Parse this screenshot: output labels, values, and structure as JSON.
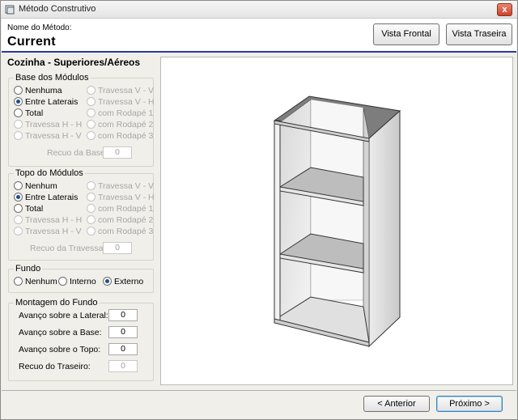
{
  "window": {
    "title": "Método Construtivo",
    "close": "x"
  },
  "header": {
    "label": "Nome do Método:",
    "value": "Current"
  },
  "toolbar": {
    "front_view": "Vista Frontal",
    "back_view": "Vista Traseira"
  },
  "section": {
    "title": "Cozinha - Superiores/Aéreos"
  },
  "base": {
    "title": "Base dos Módulos",
    "left": [
      {
        "label": "Nenhuma",
        "selected": false,
        "enabled": true
      },
      {
        "label": "Entre Laterais",
        "selected": true,
        "enabled": true
      },
      {
        "label": "Total",
        "selected": false,
        "enabled": true
      },
      {
        "label": "Travessa H - H",
        "selected": false,
        "enabled": false
      },
      {
        "label": "Travessa H - V",
        "selected": false,
        "enabled": false
      }
    ],
    "right": [
      {
        "label": "Travessa V - V",
        "selected": false,
        "enabled": false
      },
      {
        "label": "Travessa V - H",
        "selected": false,
        "enabled": false
      },
      {
        "label": "com Rodapé 1",
        "selected": false,
        "enabled": false
      },
      {
        "label": "com Rodapé 2",
        "selected": false,
        "enabled": false
      },
      {
        "label": "com Rodapé 3",
        "selected": false,
        "enabled": false
      }
    ],
    "recuo_label": "Recuo da Base:",
    "recuo_value": "0"
  },
  "topo": {
    "title": "Topo do Módulos",
    "left": [
      {
        "label": "Nenhum",
        "selected": false,
        "enabled": true
      },
      {
        "label": "Entre Laterais",
        "selected": true,
        "enabled": true
      },
      {
        "label": "Total",
        "selected": false,
        "enabled": true
      },
      {
        "label": "Travessa H - H",
        "selected": false,
        "enabled": false
      },
      {
        "label": "Travessa H - V",
        "selected": false,
        "enabled": false
      }
    ],
    "right": [
      {
        "label": "Travessa V - V",
        "selected": false,
        "enabled": false
      },
      {
        "label": "Travessa V - H",
        "selected": false,
        "enabled": false
      },
      {
        "label": "com Rodapé 1",
        "selected": false,
        "enabled": false
      },
      {
        "label": "com Rodapé 2",
        "selected": false,
        "enabled": false
      },
      {
        "label": "com Rodapé 3",
        "selected": false,
        "enabled": false
      }
    ],
    "recuo_label": "Recuo da Travessa:",
    "recuo_value": "0"
  },
  "fundo": {
    "title": "Fundo",
    "options": [
      {
        "label": "Nenhum",
        "selected": false
      },
      {
        "label": "Interno",
        "selected": false
      },
      {
        "label": "Externo",
        "selected": true
      }
    ]
  },
  "montagem": {
    "title": "Montagem do Fundo",
    "fields": [
      {
        "label": "Avanço sobre a Lateral:",
        "value": "0",
        "enabled": true
      },
      {
        "label": "Avanço sobre a Base:",
        "value": "0",
        "enabled": true
      },
      {
        "label": "Avanço sobre o Topo:",
        "value": "0",
        "enabled": true
      },
      {
        "label": "Recuo do Traseiro:",
        "value": "0",
        "enabled": false
      }
    ]
  },
  "nav": {
    "prev": "< Anterior",
    "next": "Próximo >"
  },
  "colors": {
    "accent_line": "#2b3aa0",
    "selected_radio": "#1e4f8d",
    "close_button": "#c9442a"
  }
}
